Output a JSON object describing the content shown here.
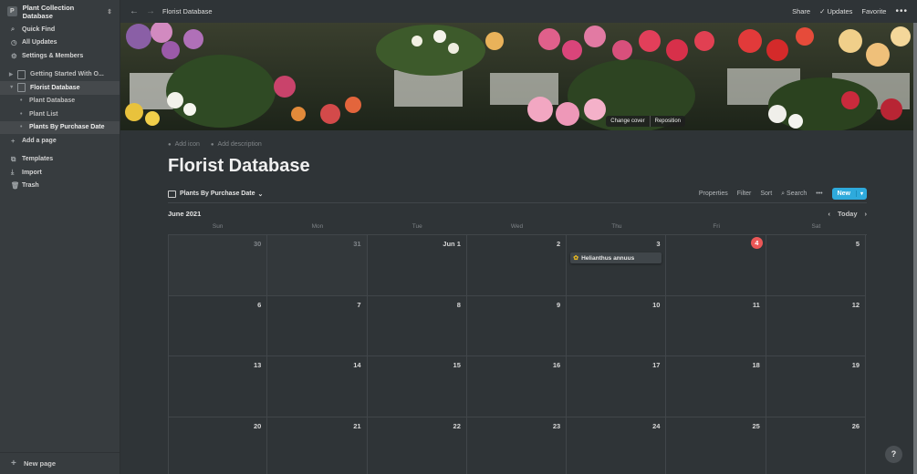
{
  "workspace": {
    "name": "Plant Collection Database",
    "icon_letter": "P"
  },
  "sidebar": {
    "quick": [
      {
        "label": "Quick Find",
        "icon": "search-icon"
      },
      {
        "label": "All Updates",
        "icon": "clock-icon"
      },
      {
        "label": "Settings & Members",
        "icon": "gear-icon"
      }
    ],
    "pages": [
      {
        "label": "Getting Started With O..."
      },
      {
        "label": "Florist Database"
      }
    ],
    "subpages": [
      "Plant Database",
      "Plant List",
      "Plants By Purchase Date"
    ],
    "add_page": "Add a page",
    "tools": [
      {
        "label": "Templates",
        "icon": "templates-icon"
      },
      {
        "label": "Import",
        "icon": "import-icon"
      },
      {
        "label": "Trash",
        "icon": "trash-icon"
      }
    ],
    "new_page": "New page"
  },
  "topbar": {
    "breadcrumb": "Florist Database",
    "share": "Share",
    "updates": "Updates",
    "favorite": "Favorite",
    "more": "•••"
  },
  "cover": {
    "change": "Change cover",
    "reposition": "Reposition"
  },
  "page": {
    "add_icon": "Add icon",
    "add_description": "Add description",
    "title": "Florist Database",
    "view_name": "Plants By Purchase Date",
    "tools": {
      "properties": "Properties",
      "filter": "Filter",
      "sort": "Sort",
      "search": "Search",
      "more": "•••",
      "new": "New"
    }
  },
  "calendar": {
    "month": "June 2021",
    "today": "Today",
    "weekdays": [
      "Sun",
      "Mon",
      "Tue",
      "Wed",
      "Thu",
      "Fri",
      "Sat"
    ],
    "days": [
      {
        "n": "30",
        "muted": true
      },
      {
        "n": "31",
        "muted": true
      },
      {
        "n": "Jun 1"
      },
      {
        "n": "2"
      },
      {
        "n": "3",
        "event": "Helianthus annuus"
      },
      {
        "n": "4",
        "today": true
      },
      {
        "n": "5"
      },
      {
        "n": "6"
      },
      {
        "n": "7"
      },
      {
        "n": "8"
      },
      {
        "n": "9"
      },
      {
        "n": "10"
      },
      {
        "n": "11"
      },
      {
        "n": "12"
      },
      {
        "n": "13"
      },
      {
        "n": "14"
      },
      {
        "n": "15"
      },
      {
        "n": "16"
      },
      {
        "n": "17"
      },
      {
        "n": "18"
      },
      {
        "n": "19"
      },
      {
        "n": "20"
      },
      {
        "n": "21"
      },
      {
        "n": "22"
      },
      {
        "n": "23"
      },
      {
        "n": "24"
      },
      {
        "n": "25"
      },
      {
        "n": "26"
      }
    ]
  },
  "help": "?"
}
